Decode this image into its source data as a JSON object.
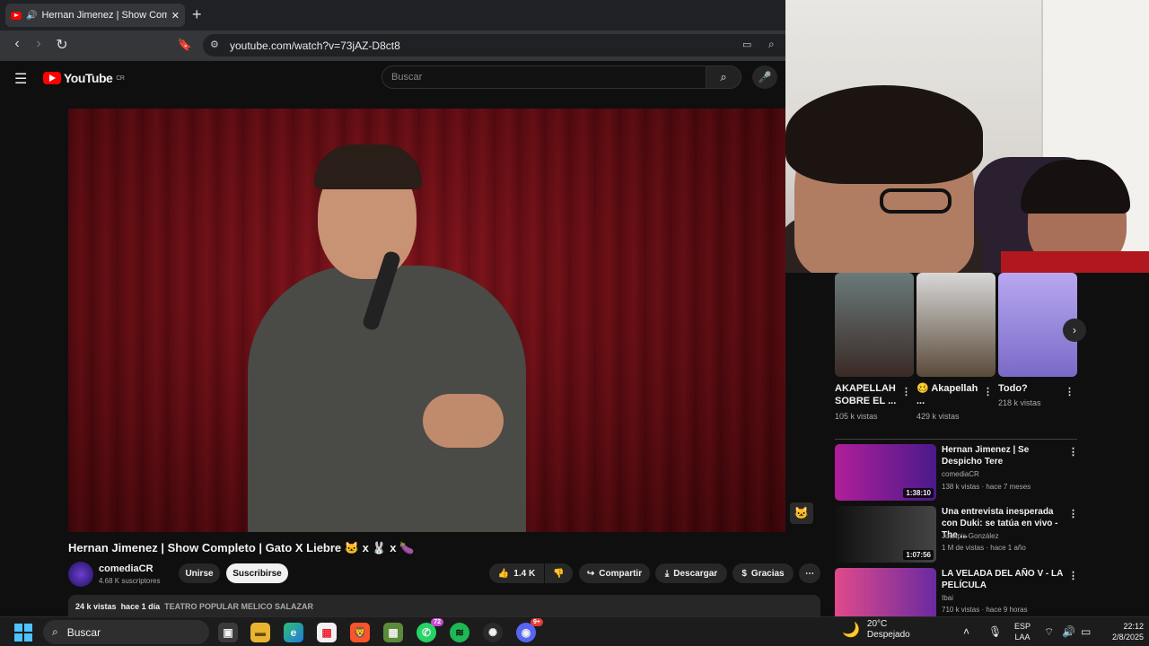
{
  "browser": {
    "tab_title": "Hernan Jimenez | Show Completo",
    "url": "youtube.com/watch?v=73jAZ-D8ct8"
  },
  "youtube": {
    "logo_text": "YouTube",
    "logo_region": "CR",
    "search_placeholder": "Buscar"
  },
  "video": {
    "title": "Hernan Jimenez | Show Completo | Gato X Liebre 🐱 x 🐰 x 🍆",
    "channel": "comediaCR",
    "subscribers": "4.68 K suscriptores",
    "join_label": "Unirse",
    "subscribe_label": "Suscribirse",
    "likes": "1.4 K",
    "share_label": "Compartir",
    "download_label": "Descargar",
    "thanks_label": "Gracias",
    "views": "24 k vistas",
    "date": "hace 1 día",
    "location": "TEATRO POPULAR MELICO SALAZAR"
  },
  "shorts": [
    {
      "title": "AKAPELLAH SOBRE EL ...",
      "views": "105 k vistas",
      "thumb_color": "#3a2a26"
    },
    {
      "title": "🥴 Akapellah ...",
      "views": "429 k vistas",
      "thumb_color": "#5a4a3a"
    },
    {
      "title": "Todo?",
      "views": "218 k vistas",
      "thumb_color": "#7a6ac8"
    }
  ],
  "recommendations": [
    {
      "title": "Hernan Jimenez | Se Despicho Tere",
      "channel": "comediaCR",
      "meta": "138 k vistas · hace 7 meses",
      "duration": "1:38:10",
      "thumb_color": "#7a1e8a"
    },
    {
      "title": "Una entrevista inesperada con Duki: se tatúa en vivo - The ...",
      "channel": "Juanpis González",
      "meta": "1 M de vistas · hace 1 año",
      "duration": "1:07:56",
      "thumb_color": "#2b2b2b"
    },
    {
      "title": "LA VELADA DEL AÑO V - LA PELÍCULA",
      "channel": "Ibai",
      "meta": "710 k vistas · hace 9 horas",
      "duration": "",
      "thumb_color": "#b03a6a"
    }
  ],
  "taskbar": {
    "search_label": "Buscar",
    "whatsapp_badge": "72",
    "discord_badge": "9+",
    "temperature": "20°C",
    "weather": "Despejado",
    "lang_top": "ESP",
    "lang_bottom": "LAA",
    "time": "22:12",
    "date": "2/8/2025"
  },
  "colors": {
    "youtube_red": "#ff0000",
    "background": "#0f0f0f"
  }
}
